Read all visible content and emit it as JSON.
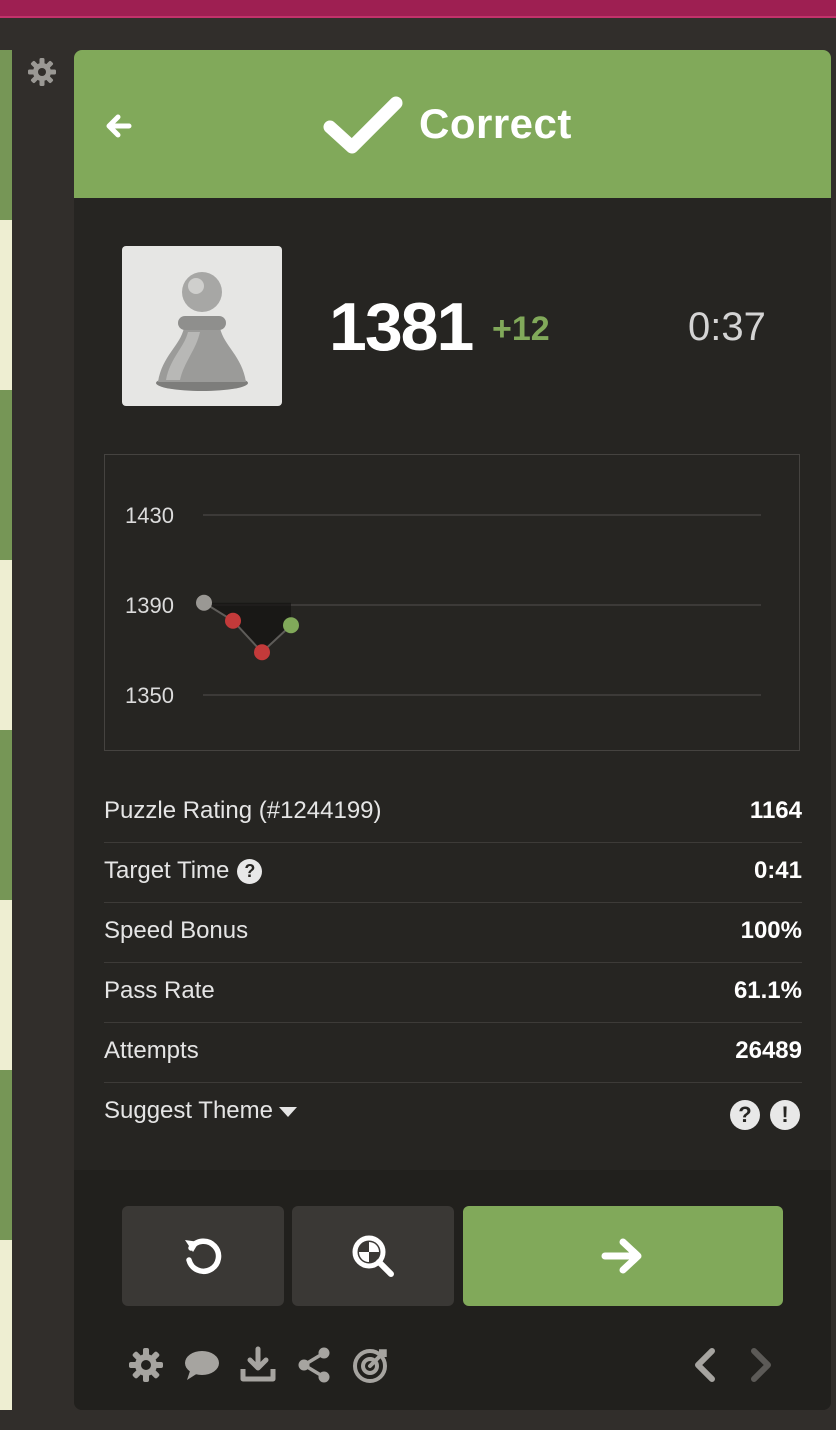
{
  "header": {
    "title": "Correct",
    "back_icon": "arrow-left-icon",
    "status_icon": "checkmark-icon"
  },
  "colors": {
    "accent_green": "#81a95a",
    "top_bar": "#9e1f52",
    "panel_bg": "#262522",
    "error_red": "#c33a3a"
  },
  "player": {
    "avatar_icon": "pawn-icon",
    "rating": "1381",
    "rating_delta": "+12",
    "time": "0:37"
  },
  "chart_data": {
    "type": "line",
    "y_ticks": [
      "1430",
      "1390",
      "1350"
    ],
    "ylim": [
      1350,
      1430
    ],
    "grid": true,
    "points": [
      {
        "x": 1,
        "y": 1391,
        "result": "start"
      },
      {
        "x": 2,
        "y": 1383,
        "result": "fail"
      },
      {
        "x": 3,
        "y": 1369,
        "result": "fail"
      },
      {
        "x": 4,
        "y": 1381,
        "result": "pass"
      }
    ]
  },
  "stats": [
    {
      "label": "Puzzle Rating (#1244199)",
      "value": "1164"
    },
    {
      "label": "Target Time",
      "value": "0:41",
      "help_icon": "?"
    },
    {
      "label": "Speed Bonus",
      "value": "100%"
    },
    {
      "label": "Pass Rate",
      "value": "61.1%"
    },
    {
      "label": "Attempts",
      "value": "26489"
    }
  ],
  "suggest_theme": {
    "label": "Suggest Theme",
    "help_icon": "?",
    "report_icon": "!"
  },
  "actions": {
    "retry_icon": "retry-icon",
    "analyze_icon": "analysis-icon",
    "next_icon": "arrow-right-icon"
  },
  "toolbar": [
    "gear-icon",
    "chat-icon",
    "download-icon",
    "share-icon",
    "target-icon",
    "chevron-left-icon",
    "chevron-right-icon"
  ]
}
